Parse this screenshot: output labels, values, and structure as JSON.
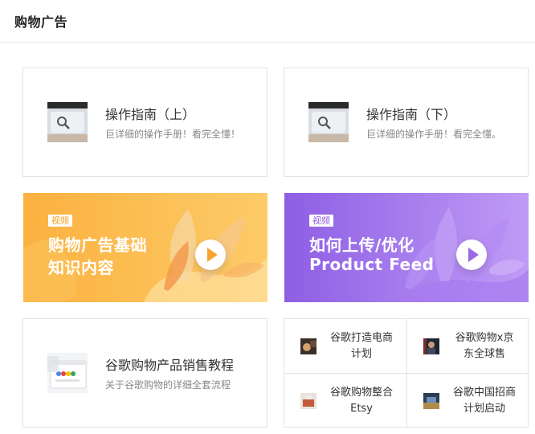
{
  "header": {
    "title": "购物广告"
  },
  "cards": [
    {
      "title": "操作指南（上）",
      "desc": "巨详细的操作手册！看完全懂！",
      "icon": "magnifier-icon"
    },
    {
      "title": "操作指南（下）",
      "desc": "巨详细的操作手册！看完全懂。",
      "icon": "magnifier-icon"
    },
    {
      "title": "谷歌购物产品销售教程",
      "desc": "关于谷歌购物的详细全套流程",
      "icon": "google-shopping-thumbnail"
    }
  ],
  "banners": [
    {
      "tag": "视频",
      "line1": "购物广告基础",
      "line2": "知识内容",
      "color_from": "#fbb13f",
      "color_to": "#fdcb68",
      "icon": "play-icon"
    },
    {
      "tag": "视频",
      "line1": "如何上传/优化",
      "line2": "Product Feed",
      "color_from": "#8e5ee4",
      "color_to": "#c09bf6",
      "icon": "play-icon"
    }
  ],
  "grid_items": [
    {
      "line1": "谷歌打造电商",
      "line2": "计划"
    },
    {
      "line1": "谷歌购物x京",
      "line2": "东全球售"
    },
    {
      "line1": "谷歌购物整合",
      "line2": "Etsy"
    },
    {
      "line1": "谷歌中国招商",
      "line2": "计划启动"
    }
  ],
  "colors": {
    "tag_orange": "#f0a21f",
    "tag_purple": "#8d5be3",
    "border": "#e3e3e3"
  }
}
